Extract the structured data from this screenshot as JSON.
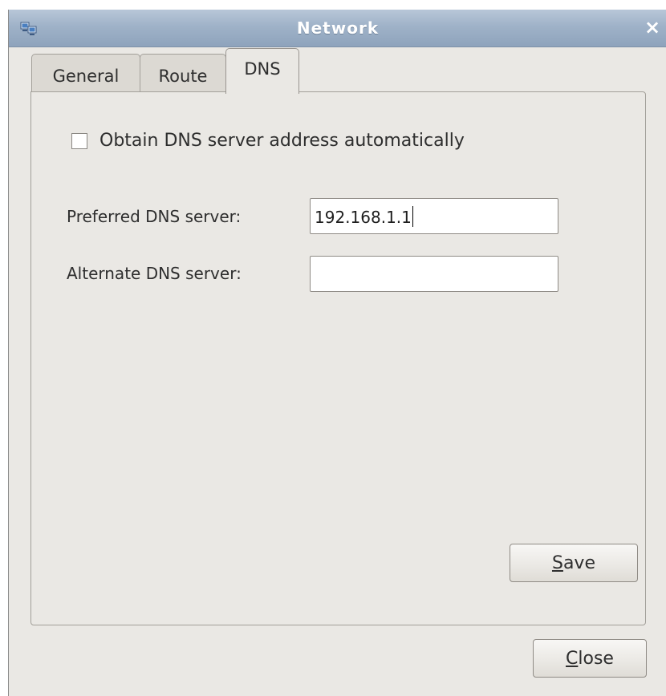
{
  "window": {
    "title": "Network",
    "close_glyph": "×",
    "app_icon": "network-computers-icon"
  },
  "tabs": [
    {
      "label": "General",
      "selected": false
    },
    {
      "label": "Route",
      "selected": false
    },
    {
      "label": "DNS",
      "selected": true
    }
  ],
  "dns": {
    "auto_label": "Obtain DNS server address automatically",
    "auto_checked": false,
    "preferred_label": "Preferred DNS server:",
    "preferred_value": "192.168.1.1",
    "alternate_label": "Alternate DNS server:",
    "alternate_value": "",
    "save_mnemonic": "S",
    "save_rest": "ave"
  },
  "footer": {
    "close_mnemonic": "C",
    "close_rest": "lose"
  },
  "colors": {
    "titlebar": "#9fb2c8",
    "window_bg": "#eae8e4"
  }
}
